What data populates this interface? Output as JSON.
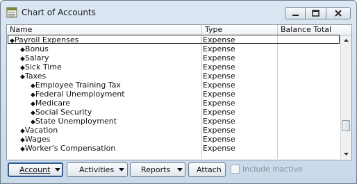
{
  "window": {
    "title": "Chart of Accounts"
  },
  "columns": {
    "name": "Name",
    "type": "Type",
    "balance": "Balance Total"
  },
  "rows": [
    {
      "name": "Payroll Expenses",
      "type": "Expense",
      "level": 0
    },
    {
      "name": "Bonus",
      "type": "Expense",
      "level": 1
    },
    {
      "name": "Salary",
      "type": "Expense",
      "level": 1
    },
    {
      "name": "Sick Time",
      "type": "Expense",
      "level": 1
    },
    {
      "name": "Taxes",
      "type": "Expense",
      "level": 1
    },
    {
      "name": "Employee Training Tax",
      "type": "Expense",
      "level": 2
    },
    {
      "name": "Federal Unemployment",
      "type": "Expense",
      "level": 2
    },
    {
      "name": "Medicare",
      "type": "Expense",
      "level": 2
    },
    {
      "name": "Social Security",
      "type": "Expense",
      "level": 2
    },
    {
      "name": "State Unemployment",
      "type": "Expense",
      "level": 2
    },
    {
      "name": "Vacation",
      "type": "Expense",
      "level": 1
    },
    {
      "name": "Wages",
      "type": "Expense",
      "level": 1
    },
    {
      "name": "Worker's Compensation",
      "type": "Expense",
      "level": 1
    }
  ],
  "buttons": {
    "account": "Account",
    "activities": "Activities",
    "reports": "Reports",
    "attach": "Attach"
  },
  "include_inactive": {
    "label": "Include inactive",
    "checked": false,
    "enabled": false
  },
  "icons": {
    "app": "chart-of-accounts-icon",
    "minimize": "minimize-icon",
    "maximize": "maximize-icon",
    "close": "close-icon",
    "row_marker": "diamond-bullet-icon"
  }
}
